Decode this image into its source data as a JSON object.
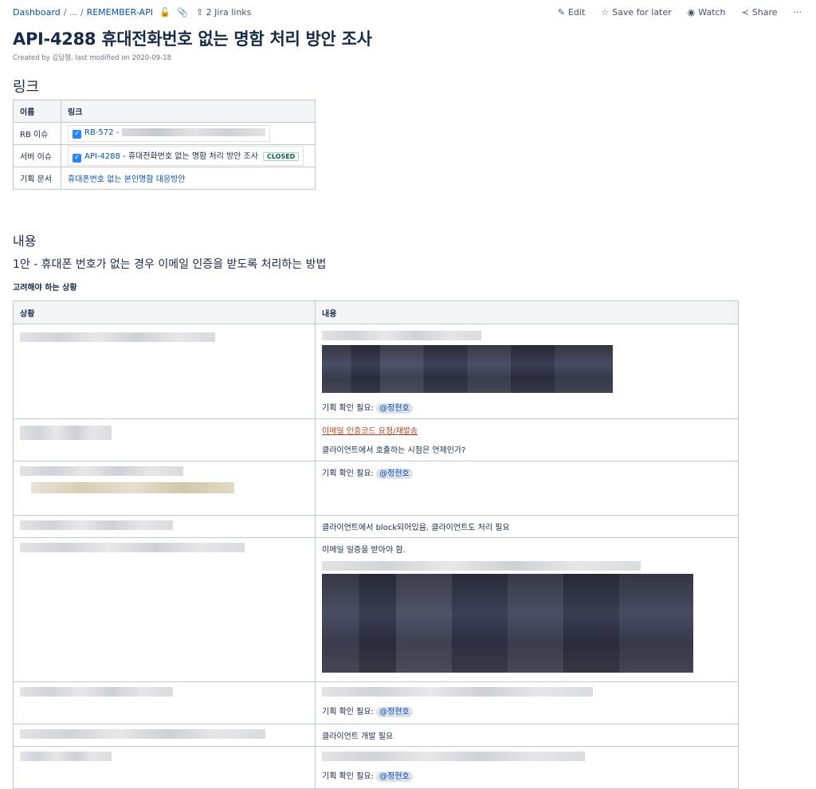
{
  "breadcrumb": {
    "root": "Dashboard",
    "ellipsis": "/ ... /",
    "space": "REMEMBER-API",
    "jira_links": "2 Jira links"
  },
  "actions": {
    "edit": "Edit",
    "save_for_later": "Save for later",
    "watch": "Watch",
    "share": "Share",
    "more": "···"
  },
  "page": {
    "title": "API-4288 휴대전화번호 없는 명함 처리 방안 조사",
    "byline": "Created by 김담형, last modified on 2020-09-18"
  },
  "links_section": {
    "heading": "링크",
    "headers": [
      "이름",
      "링크"
    ],
    "rows": [
      {
        "name": "RB 이슈",
        "key": "RB-572",
        "sep": " -"
      },
      {
        "name": "서버 이슈",
        "key": "API-4288",
        "summary": " - 휴대전화번호 없는 명함 처리 방안 조사",
        "status": "CLOSED"
      },
      {
        "name": "기획 문서",
        "doc_link": "휴대폰번호 없는 본인명함 대응방안"
      }
    ]
  },
  "content_section": {
    "heading": "내용",
    "plan_heading": "1안 - 휴대폰 번호가 없는 경우 이메일 인증을 받도록 처리하는 방법",
    "situations_heading": "고려해야 하는 상황",
    "headers": [
      "상황",
      "내용"
    ],
    "check_label": "기획 확인 필요:",
    "mention": "@정현호",
    "row2_link": "이메일 인증코드 요청/재발송",
    "row2_text": "클라이언트에서 호출하는 시점은 언제인가?",
    "row4_text": "클라이언트에서 block되어있음. 클라이언트도 처리 필요",
    "row5_text": "이메일 일증을 받아야 함.",
    "row7_text": "클라이언트 개발 필요"
  }
}
